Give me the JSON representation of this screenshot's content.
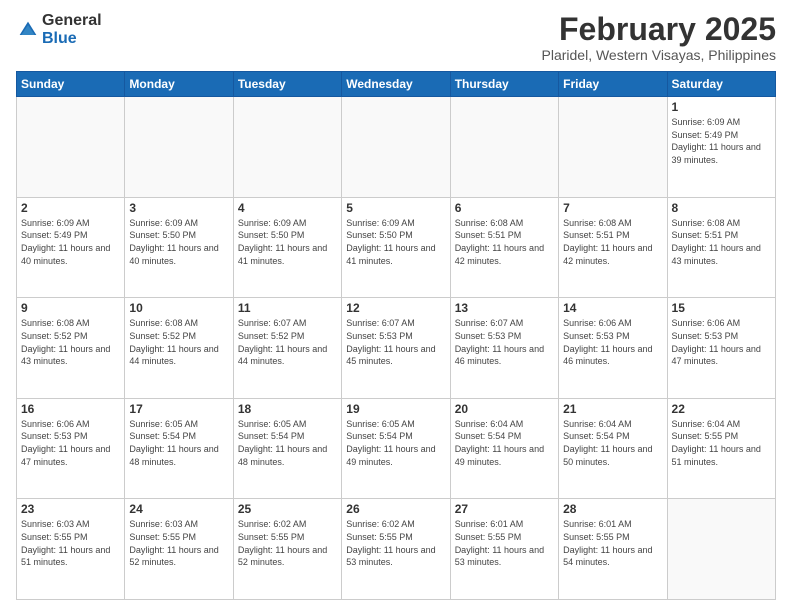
{
  "logo": {
    "general": "General",
    "blue": "Blue"
  },
  "header": {
    "month": "February 2025",
    "location": "Plaridel, Western Visayas, Philippines"
  },
  "weekdays": [
    "Sunday",
    "Monday",
    "Tuesday",
    "Wednesday",
    "Thursday",
    "Friday",
    "Saturday"
  ],
  "weeks": [
    [
      {
        "day": "",
        "sunrise": "",
        "sunset": "",
        "daylight": "",
        "empty": true
      },
      {
        "day": "",
        "sunrise": "",
        "sunset": "",
        "daylight": "",
        "empty": true
      },
      {
        "day": "",
        "sunrise": "",
        "sunset": "",
        "daylight": "",
        "empty": true
      },
      {
        "day": "",
        "sunrise": "",
        "sunset": "",
        "daylight": "",
        "empty": true
      },
      {
        "day": "",
        "sunrise": "",
        "sunset": "",
        "daylight": "",
        "empty": true
      },
      {
        "day": "",
        "sunrise": "",
        "sunset": "",
        "daylight": "",
        "empty": true
      },
      {
        "day": "1",
        "sunrise": "6:09 AM",
        "sunset": "5:49 PM",
        "daylight": "11 hours and 39 minutes.",
        "empty": false
      }
    ],
    [
      {
        "day": "2",
        "sunrise": "6:09 AM",
        "sunset": "5:49 PM",
        "daylight": "11 hours and 40 minutes.",
        "empty": false
      },
      {
        "day": "3",
        "sunrise": "6:09 AM",
        "sunset": "5:50 PM",
        "daylight": "11 hours and 40 minutes.",
        "empty": false
      },
      {
        "day": "4",
        "sunrise": "6:09 AM",
        "sunset": "5:50 PM",
        "daylight": "11 hours and 41 minutes.",
        "empty": false
      },
      {
        "day": "5",
        "sunrise": "6:09 AM",
        "sunset": "5:50 PM",
        "daylight": "11 hours and 41 minutes.",
        "empty": false
      },
      {
        "day": "6",
        "sunrise": "6:08 AM",
        "sunset": "5:51 PM",
        "daylight": "11 hours and 42 minutes.",
        "empty": false
      },
      {
        "day": "7",
        "sunrise": "6:08 AM",
        "sunset": "5:51 PM",
        "daylight": "11 hours and 42 minutes.",
        "empty": false
      },
      {
        "day": "8",
        "sunrise": "6:08 AM",
        "sunset": "5:51 PM",
        "daylight": "11 hours and 43 minutes.",
        "empty": false
      }
    ],
    [
      {
        "day": "9",
        "sunrise": "6:08 AM",
        "sunset": "5:52 PM",
        "daylight": "11 hours and 43 minutes.",
        "empty": false
      },
      {
        "day": "10",
        "sunrise": "6:08 AM",
        "sunset": "5:52 PM",
        "daylight": "11 hours and 44 minutes.",
        "empty": false
      },
      {
        "day": "11",
        "sunrise": "6:07 AM",
        "sunset": "5:52 PM",
        "daylight": "11 hours and 44 minutes.",
        "empty": false
      },
      {
        "day": "12",
        "sunrise": "6:07 AM",
        "sunset": "5:53 PM",
        "daylight": "11 hours and 45 minutes.",
        "empty": false
      },
      {
        "day": "13",
        "sunrise": "6:07 AM",
        "sunset": "5:53 PM",
        "daylight": "11 hours and 46 minutes.",
        "empty": false
      },
      {
        "day": "14",
        "sunrise": "6:06 AM",
        "sunset": "5:53 PM",
        "daylight": "11 hours and 46 minutes.",
        "empty": false
      },
      {
        "day": "15",
        "sunrise": "6:06 AM",
        "sunset": "5:53 PM",
        "daylight": "11 hours and 47 minutes.",
        "empty": false
      }
    ],
    [
      {
        "day": "16",
        "sunrise": "6:06 AM",
        "sunset": "5:53 PM",
        "daylight": "11 hours and 47 minutes.",
        "empty": false
      },
      {
        "day": "17",
        "sunrise": "6:05 AM",
        "sunset": "5:54 PM",
        "daylight": "11 hours and 48 minutes.",
        "empty": false
      },
      {
        "day": "18",
        "sunrise": "6:05 AM",
        "sunset": "5:54 PM",
        "daylight": "11 hours and 48 minutes.",
        "empty": false
      },
      {
        "day": "19",
        "sunrise": "6:05 AM",
        "sunset": "5:54 PM",
        "daylight": "11 hours and 49 minutes.",
        "empty": false
      },
      {
        "day": "20",
        "sunrise": "6:04 AM",
        "sunset": "5:54 PM",
        "daylight": "11 hours and 49 minutes.",
        "empty": false
      },
      {
        "day": "21",
        "sunrise": "6:04 AM",
        "sunset": "5:54 PM",
        "daylight": "11 hours and 50 minutes.",
        "empty": false
      },
      {
        "day": "22",
        "sunrise": "6:04 AM",
        "sunset": "5:55 PM",
        "daylight": "11 hours and 51 minutes.",
        "empty": false
      }
    ],
    [
      {
        "day": "23",
        "sunrise": "6:03 AM",
        "sunset": "5:55 PM",
        "daylight": "11 hours and 51 minutes.",
        "empty": false
      },
      {
        "day": "24",
        "sunrise": "6:03 AM",
        "sunset": "5:55 PM",
        "daylight": "11 hours and 52 minutes.",
        "empty": false
      },
      {
        "day": "25",
        "sunrise": "6:02 AM",
        "sunset": "5:55 PM",
        "daylight": "11 hours and 52 minutes.",
        "empty": false
      },
      {
        "day": "26",
        "sunrise": "6:02 AM",
        "sunset": "5:55 PM",
        "daylight": "11 hours and 53 minutes.",
        "empty": false
      },
      {
        "day": "27",
        "sunrise": "6:01 AM",
        "sunset": "5:55 PM",
        "daylight": "11 hours and 53 minutes.",
        "empty": false
      },
      {
        "day": "28",
        "sunrise": "6:01 AM",
        "sunset": "5:55 PM",
        "daylight": "11 hours and 54 minutes.",
        "empty": false
      },
      {
        "day": "",
        "sunrise": "",
        "sunset": "",
        "daylight": "",
        "empty": true
      }
    ]
  ],
  "labels": {
    "sunrise_prefix": "Sunrise: ",
    "sunset_prefix": "Sunset: ",
    "daylight_prefix": "Daylight: "
  }
}
